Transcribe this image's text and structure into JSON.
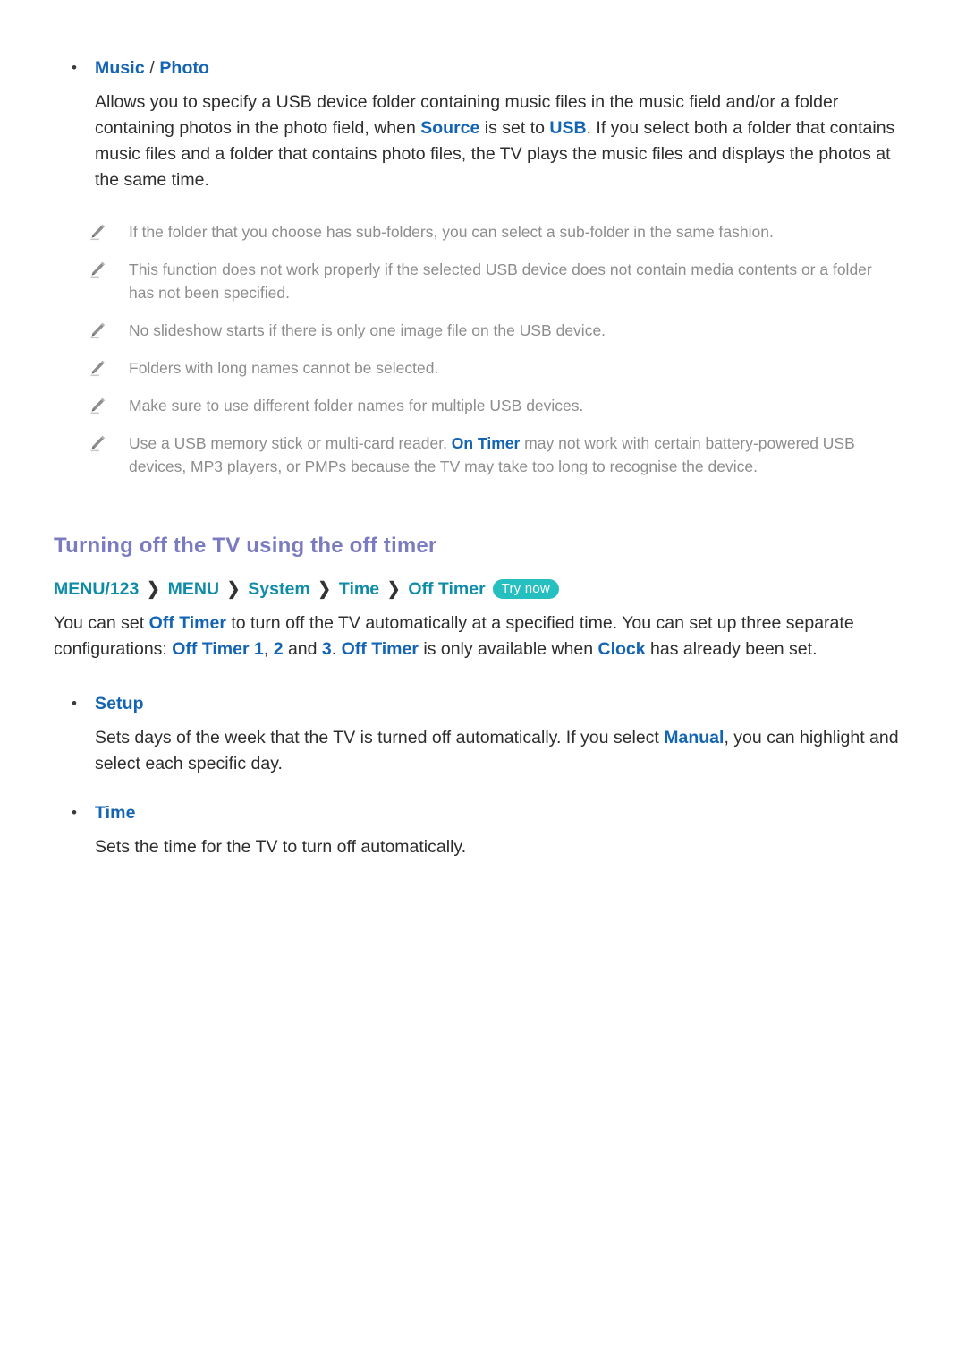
{
  "document": {
    "sections": [
      {
        "id": "music-photo",
        "bullet_label_parts": {
          "first": "Music",
          "separator": " / ",
          "second": "Photo"
        },
        "paragraph": {
          "p1": "Allows you to specify a USB device folder containing music files in the music field and/or a folder containing photos in the photo field, when ",
          "term1": "Source",
          "p2": " is set to ",
          "term2": "USB",
          "p3": ". If you select both a folder that contains music files and a folder that contains photo files, the TV plays the music files and displays the photos at the same time."
        },
        "notes": [
          {
            "icon": "pencil-icon",
            "text": "If the folder that you choose has sub-folders, you can select a sub-folder in the same fashion."
          },
          {
            "icon": "pencil-icon",
            "text": "This function does not work properly if the selected USB device does not contain media contents or a folder has not been specified."
          },
          {
            "icon": "pencil-icon",
            "text": "No slideshow starts if there is only one image file on the USB device."
          },
          {
            "icon": "pencil-icon",
            "text": "Folders with long names cannot be selected."
          },
          {
            "icon": "pencil-icon",
            "text": "Make sure to use different folder names for multiple USB devices."
          },
          {
            "icon": "pencil-icon",
            "text_p1": "Use a USB memory stick or multi-card reader. ",
            "term1": "On Timer",
            "text_p2": " may not work with certain battery-powered USB devices, MP3 players, or PMPs because the TV may take too long to recognise the device."
          }
        ]
      },
      {
        "id": "off-timer",
        "heading": "Turning off the TV using the off timer",
        "breadcrumb": {
          "crumbs": [
            "MENU/123",
            "MENU",
            "System",
            "Time",
            "Off Timer"
          ],
          "separator": "❯",
          "badge": "Try now"
        },
        "paragraph": {
          "p1": "You can set ",
          "term1": "Off Timer",
          "p2": " to turn off the TV automatically at a specified time. You can set up three separate configurations: ",
          "term2": "Off Timer 1",
          "p3": ", ",
          "term3": "2",
          "p4": " and ",
          "term4": "3",
          "p5": ". ",
          "term5": "Off Timer",
          "p6": " is only available when ",
          "term6": "Clock",
          "p7": " has already been set."
        },
        "subsections": [
          {
            "bullet_label": "Setup",
            "paragraph": {
              "p1": "Sets days of the week that the TV is turned off automatically. If you select ",
              "term1": "Manual",
              "p2": ", you can highlight and select each specific day."
            }
          },
          {
            "bullet_label": "Time",
            "paragraph": {
              "p1": "Sets the time for the TV to turn off automatically."
            }
          }
        ]
      }
    ],
    "bullet_glyph": "•",
    "colors": {
      "term_blue": "#1464b4",
      "heading_purple": "#7b7bc2",
      "breadcrumb_teal": "#0e8ca8",
      "badge_teal": "#25bfbf",
      "note_gray": "#8d8d8d",
      "body_text": "#2d2d2d",
      "background": "#ffffff"
    }
  }
}
